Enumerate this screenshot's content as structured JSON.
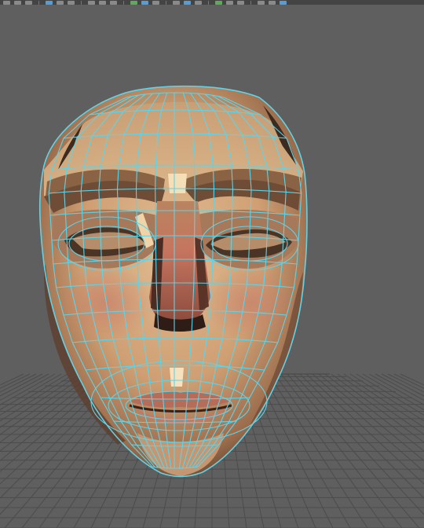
{
  "app": {
    "viewport_label": "3D viewport",
    "object": "head-mesh"
  },
  "toolbar": {
    "tools": [
      {
        "icon": "select-icon",
        "state": "normal"
      },
      {
        "icon": "lasso-icon",
        "state": "normal"
      },
      {
        "icon": "paint-icon",
        "state": "normal"
      },
      {
        "icon": "sep",
        "state": "sep"
      },
      {
        "icon": "grid-icon",
        "state": "active"
      },
      {
        "icon": "snap-curve-icon",
        "state": "normal"
      },
      {
        "icon": "snap-point-icon",
        "state": "normal"
      },
      {
        "icon": "sep",
        "state": "sep"
      },
      {
        "icon": "history-icon",
        "state": "normal"
      },
      {
        "icon": "input-icon",
        "state": "normal"
      },
      {
        "icon": "output-icon",
        "state": "normal"
      },
      {
        "icon": "sep",
        "state": "sep"
      },
      {
        "icon": "magnet-icon",
        "state": "green"
      },
      {
        "icon": "camera-icon",
        "state": "active"
      },
      {
        "icon": "render-icon",
        "state": "normal"
      },
      {
        "icon": "sep",
        "state": "sep"
      },
      {
        "icon": "ipr-icon",
        "state": "normal"
      },
      {
        "icon": "shading-icon",
        "state": "active"
      },
      {
        "icon": "light-icon",
        "state": "normal"
      },
      {
        "icon": "sep",
        "state": "sep"
      },
      {
        "icon": "isolate-icon",
        "state": "green"
      },
      {
        "icon": "xray-icon",
        "state": "normal"
      },
      {
        "icon": "wireframe-icon",
        "state": "normal"
      },
      {
        "icon": "sep",
        "state": "sep"
      },
      {
        "icon": "frame-icon",
        "state": "normal"
      },
      {
        "icon": "resolution-icon",
        "state": "normal"
      },
      {
        "icon": "gate-icon",
        "state": "active"
      }
    ]
  },
  "colors": {
    "viewport_bg": "#5f5f5f",
    "grid_line": "#4c4c4c",
    "grid_edge": "#444444",
    "wireframe": "#5fd3e8",
    "skin_light": "#d8b186",
    "skin_mid": "#c79a6e",
    "skin_shadow": "#7d5a3e",
    "skin_dark": "#3e2d22",
    "lip_red": "#c07463",
    "nose_red": "#c9725f",
    "highlight": "#f6e2be"
  }
}
